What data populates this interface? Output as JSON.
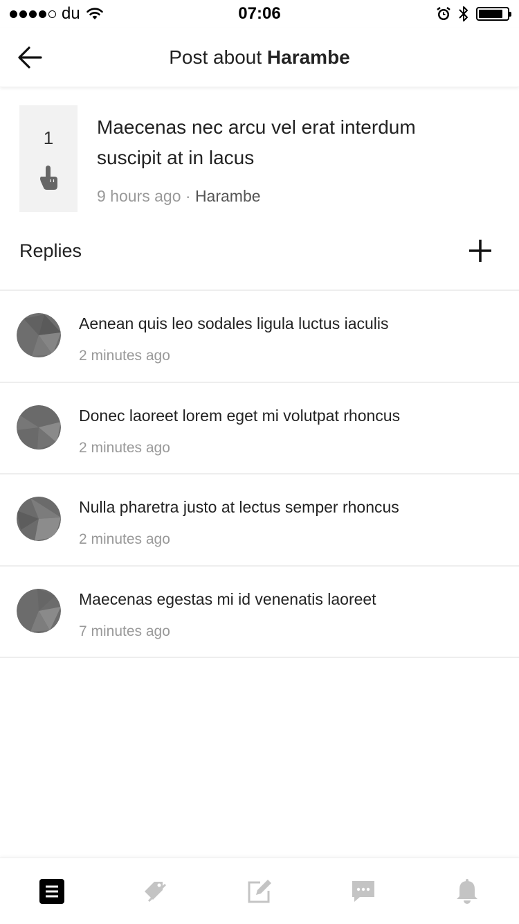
{
  "status_bar": {
    "carrier": "du",
    "time": "07:06",
    "battery_level": 0.85
  },
  "header": {
    "title_prefix": "Post about",
    "title_topic": "Harambe",
    "back_icon": "arrow-left-icon"
  },
  "post": {
    "votes": "1",
    "vote_icon": "pointing-finger-icon",
    "title": "Maecenas nec arcu vel erat interdum suscipit at in lacus",
    "time": "9 hours ago",
    "separator": " · ",
    "author": "Harambe"
  },
  "replies_section": {
    "title": "Replies",
    "add_icon": "plus-icon"
  },
  "replies": [
    {
      "text": "Aenean quis leo sodales ligula luctus iaculis",
      "time": "2 minutes ago"
    },
    {
      "text": "Donec laoreet lorem eget mi volutpat rhoncus",
      "time": "2 minutes ago"
    },
    {
      "text": "Nulla pharetra justo at lectus semper rhoncus",
      "time": "2 minutes ago"
    },
    {
      "text": "Maecenas egestas mi id venenatis laoreet",
      "time": "7 minutes ago"
    }
  ],
  "tab_bar": {
    "tabs": [
      {
        "icon": "list-icon",
        "active": true
      },
      {
        "icon": "tag-icon",
        "active": false
      },
      {
        "icon": "compose-icon",
        "active": false
      },
      {
        "icon": "chat-icon",
        "active": false
      },
      {
        "icon": "bell-icon",
        "active": false
      }
    ]
  },
  "colors": {
    "active_tab": "#000000",
    "inactive_tab": "#c4c4c4",
    "muted_text": "#999999",
    "vote_box_bg": "#f2f2f2"
  }
}
